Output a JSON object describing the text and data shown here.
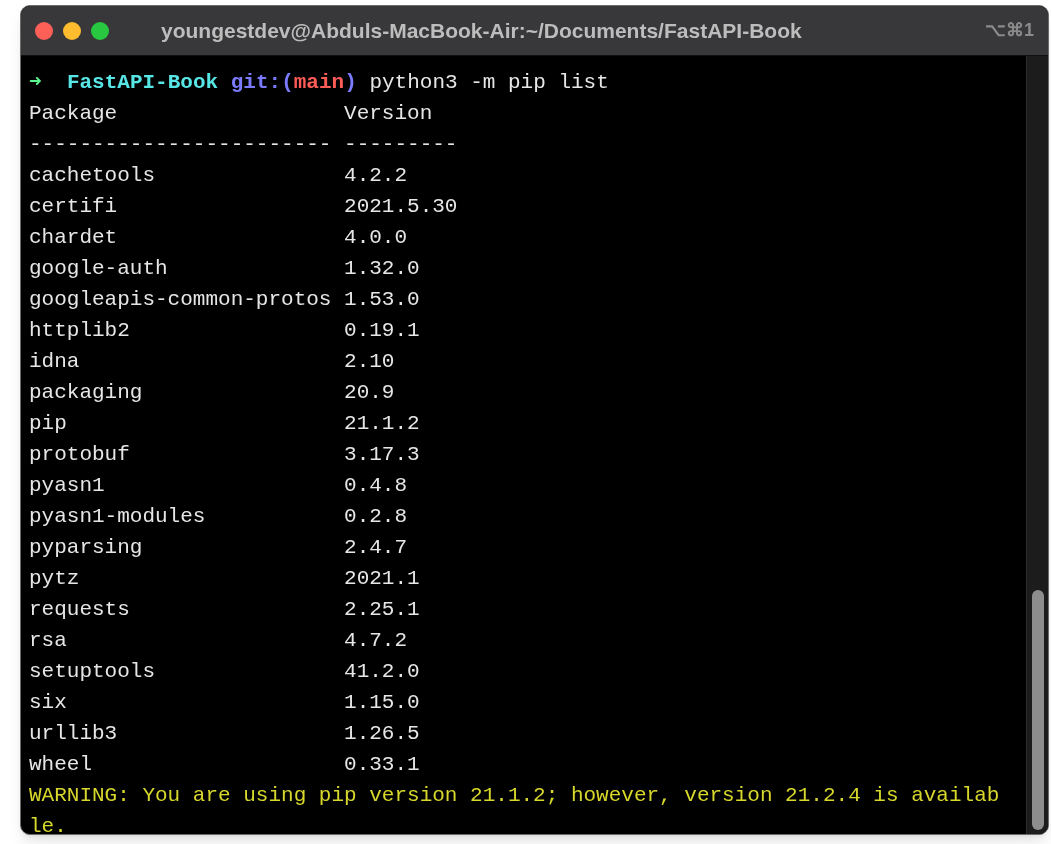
{
  "window": {
    "title": "youngestdev@Abduls-MacBook-Air:~/Documents/FastAPI-Book",
    "shortcut": "⌥⌘1"
  },
  "prompt": {
    "arrow": "➜",
    "directory": "FastAPI-Book",
    "git_open": "git:(",
    "branch": "main",
    "git_close": ")",
    "command": "python3 -m pip list"
  },
  "table": {
    "columns": [
      "Package",
      "Version"
    ],
    "separators": [
      "------------------------",
      "---------"
    ],
    "rows": [
      {
        "package": "cachetools",
        "version": "4.2.2"
      },
      {
        "package": "certifi",
        "version": "2021.5.30"
      },
      {
        "package": "chardet",
        "version": "4.0.0"
      },
      {
        "package": "google-auth",
        "version": "1.32.0"
      },
      {
        "package": "googleapis-common-protos",
        "version": "1.53.0"
      },
      {
        "package": "httplib2",
        "version": "0.19.1"
      },
      {
        "package": "idna",
        "version": "2.10"
      },
      {
        "package": "packaging",
        "version": "20.9"
      },
      {
        "package": "pip",
        "version": "21.1.2"
      },
      {
        "package": "protobuf",
        "version": "3.17.3"
      },
      {
        "package": "pyasn1",
        "version": "0.4.8"
      },
      {
        "package": "pyasn1-modules",
        "version": "0.2.8"
      },
      {
        "package": "pyparsing",
        "version": "2.4.7"
      },
      {
        "package": "pytz",
        "version": "2021.1"
      },
      {
        "package": "requests",
        "version": "2.25.1"
      },
      {
        "package": "rsa",
        "version": "4.7.2"
      },
      {
        "package": "setuptools",
        "version": "41.2.0"
      },
      {
        "package": "six",
        "version": "1.15.0"
      },
      {
        "package": "urllib3",
        "version": "1.26.5"
      },
      {
        "package": "wheel",
        "version": "0.33.1"
      }
    ]
  },
  "warning": [
    "WARNING: You are using pip version 21.1.2; however, version 21.2.4 is availab",
    "le."
  ]
}
